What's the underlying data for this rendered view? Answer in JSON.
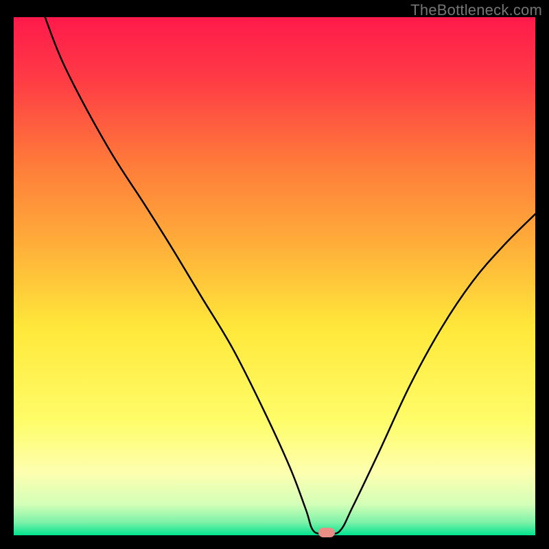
{
  "watermark": "TheBottleneck.com",
  "chart_data": {
    "type": "line",
    "title": "",
    "xlabel": "",
    "ylabel": "",
    "xlim": [
      0,
      100
    ],
    "ylim": [
      0,
      100
    ],
    "grid": false,
    "legend": false,
    "background_gradient": {
      "stops": [
        {
          "pos": 0.0,
          "color": "#ff1a4b"
        },
        {
          "pos": 0.12,
          "color": "#ff3b45"
        },
        {
          "pos": 0.28,
          "color": "#ff7a3a"
        },
        {
          "pos": 0.45,
          "color": "#ffb23a"
        },
        {
          "pos": 0.6,
          "color": "#ffe83a"
        },
        {
          "pos": 0.78,
          "color": "#fffd6a"
        },
        {
          "pos": 0.88,
          "color": "#fdffb0"
        },
        {
          "pos": 0.94,
          "color": "#d4ffb8"
        },
        {
          "pos": 0.975,
          "color": "#7df2a8"
        },
        {
          "pos": 1.0,
          "color": "#00e38f"
        }
      ]
    },
    "series": [
      {
        "name": "bottleneck-curve",
        "color": "#000000",
        "width": 2.5,
        "points": [
          {
            "x": 6.0,
            "y": 100.0
          },
          {
            "x": 10.0,
            "y": 90.0
          },
          {
            "x": 18.0,
            "y": 75.0
          },
          {
            "x": 25.0,
            "y": 64.0
          },
          {
            "x": 30.0,
            "y": 56.0
          },
          {
            "x": 36.0,
            "y": 46.0
          },
          {
            "x": 42.0,
            "y": 36.0
          },
          {
            "x": 48.0,
            "y": 24.0
          },
          {
            "x": 53.0,
            "y": 13.0
          },
          {
            "x": 56.0,
            "y": 5.0
          },
          {
            "x": 57.5,
            "y": 0.8
          },
          {
            "x": 60.0,
            "y": 0.5
          },
          {
            "x": 62.5,
            "y": 0.8
          },
          {
            "x": 65.0,
            "y": 5.5
          },
          {
            "x": 70.0,
            "y": 16.0
          },
          {
            "x": 76.0,
            "y": 29.0
          },
          {
            "x": 82.0,
            "y": 40.0
          },
          {
            "x": 88.0,
            "y": 49.0
          },
          {
            "x": 94.0,
            "y": 56.0
          },
          {
            "x": 100.0,
            "y": 62.0
          }
        ]
      }
    ],
    "marker": {
      "name": "optimal-point",
      "x": 60.0,
      "y": 0.5,
      "color": "#e98d86"
    }
  }
}
